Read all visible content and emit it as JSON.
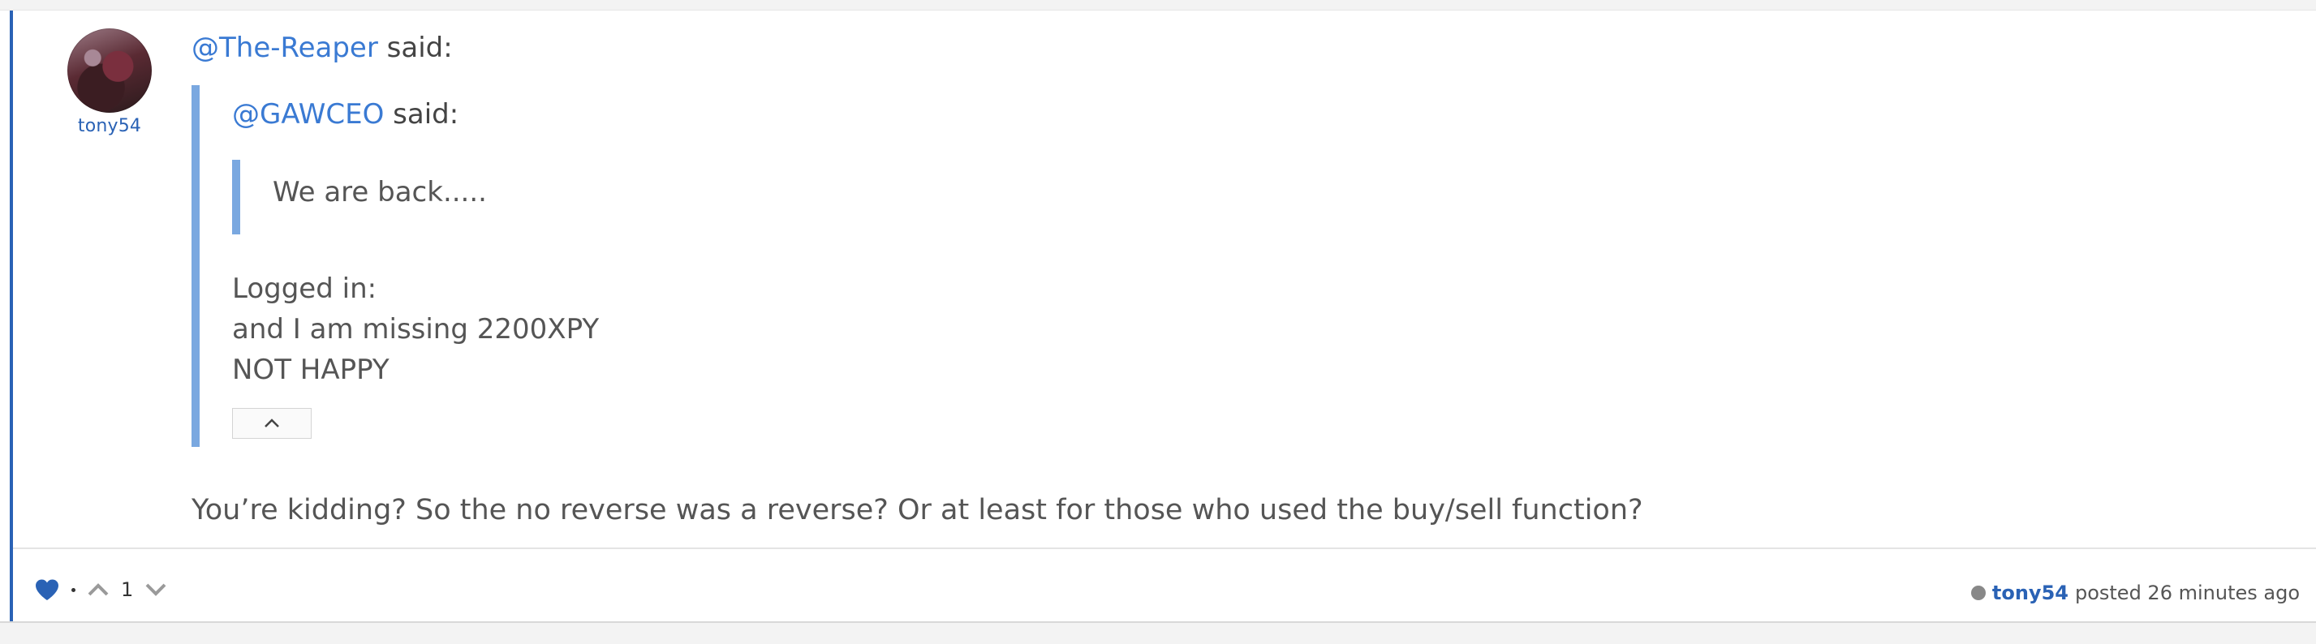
{
  "post": {
    "author": "tony54",
    "said_line": {
      "mention": "@The-Reaper",
      "suffix": " said:"
    },
    "quote": {
      "mention": "@GAWCEO",
      "suffix": " said:",
      "nested_quote": "We are back.....",
      "lines": [
        "Logged in:",
        "and I am missing 2200XPY",
        "NOT HAPPY"
      ]
    },
    "body": "You’re kidding? So the no reverse was a reverse? Or at least for those who used the buy/sell function?",
    "footer": {
      "vote_count": "1",
      "meta_user": "tony54",
      "meta_text": "posted 26 minutes ago"
    }
  },
  "icons": {
    "like": "heart-icon",
    "upvote": "chevron-up-icon",
    "downvote": "chevron-down-icon",
    "collapse": "chevron-up-icon",
    "status": "status-dot-icon"
  },
  "colors": {
    "accent": "#2a62b5",
    "link": "#3a7ad3",
    "quote_bar": "#7aa8e0"
  }
}
